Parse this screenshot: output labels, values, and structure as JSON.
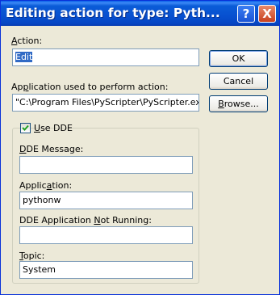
{
  "window": {
    "title": "Editing action for type: Pyth...",
    "help_glyph": "?",
    "close_glyph": "X"
  },
  "action": {
    "label_prefix": "",
    "label_mnemonic": "A",
    "label_rest": "ction:",
    "value": "Edit"
  },
  "application_path": {
    "label_prefix": "Ap",
    "label_mnemonic": "p",
    "label_rest": "lication used to perform action:",
    "value": "\"C:\\Program Files\\PyScripter\\PyScripter.exe\" \""
  },
  "buttons": {
    "ok": "OK",
    "cancel": "Cancel",
    "browse_mnemonic": "B",
    "browse_rest": "rowse..."
  },
  "dde": {
    "checkbox_mnemonic": "U",
    "checkbox_rest": "se DDE",
    "checked": true,
    "message_mnemonic": "D",
    "message_rest": "DE Message:",
    "message_value": "",
    "application_prefix": "Applic",
    "application_mnemonic": "a",
    "application_rest": "tion:",
    "application_value": "pythonw",
    "not_running_prefix": "DDE Application ",
    "not_running_mnemonic": "N",
    "not_running_rest": "ot Running:",
    "not_running_value": "",
    "topic_mnemonic": "T",
    "topic_rest": "opic:",
    "topic_value": "System"
  },
  "colors": {
    "title_bar": "#0750d0",
    "dialog_bg": "#ece9d8",
    "selection": "#316ac5",
    "close_button": "#c8401e"
  }
}
